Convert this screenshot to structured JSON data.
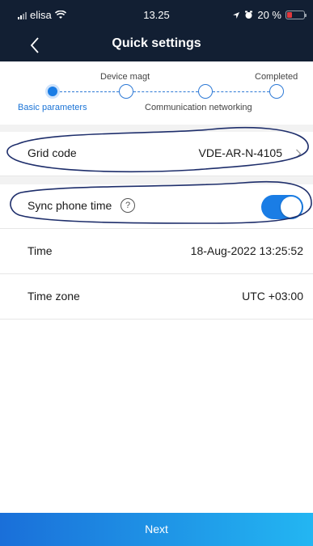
{
  "status_bar": {
    "carrier": "elisa",
    "time": "13.25",
    "battery": "20 %"
  },
  "nav": {
    "title": "Quick settings",
    "back_icon": "chevron-left-icon"
  },
  "stepper": {
    "steps": [
      {
        "label": "Basic parameters",
        "active": true
      },
      {
        "label": "Device magt",
        "active": false
      },
      {
        "label": "Communication networking",
        "active": false
      },
      {
        "label": "Completed",
        "active": false
      }
    ]
  },
  "settings": {
    "grid_code": {
      "label": "Grid code",
      "value": "VDE-AR-N-4105"
    },
    "sync_phone_time": {
      "label": "Sync phone time",
      "help": "?",
      "enabled": true
    },
    "time": {
      "label": "Time",
      "value": "18-Aug-2022 13:25:52"
    },
    "time_zone": {
      "label": "Time zone",
      "value": "UTC +03:00"
    }
  },
  "footer": {
    "next_label": "Next"
  },
  "colors": {
    "header_bg": "#121f33",
    "accent": "#1a7de5",
    "annotation_ink": "#1e2e6b"
  }
}
